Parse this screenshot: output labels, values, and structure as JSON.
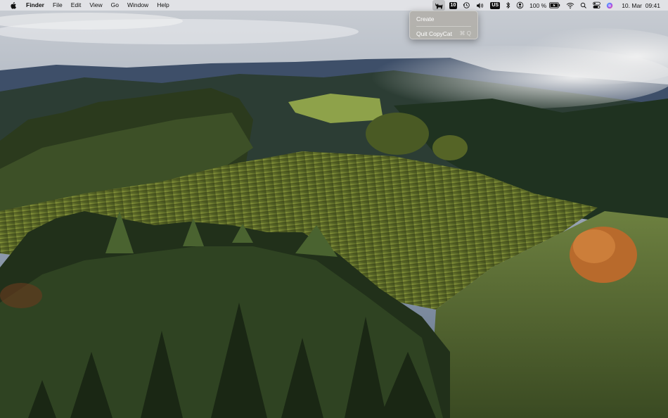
{
  "menubar": {
    "app_name": "Finder",
    "menus": [
      "File",
      "Edit",
      "View",
      "Go",
      "Window",
      "Help"
    ],
    "status": {
      "calendar_badge": "10",
      "input_source": "US",
      "battery_percent": "100 %",
      "datetime": "10. Mar  09:41"
    }
  },
  "dropdown": {
    "items": [
      {
        "label": "Create",
        "shortcut": ""
      },
      {
        "label": "Quit CopyCat",
        "shortcut": "⌘ Q"
      }
    ]
  }
}
